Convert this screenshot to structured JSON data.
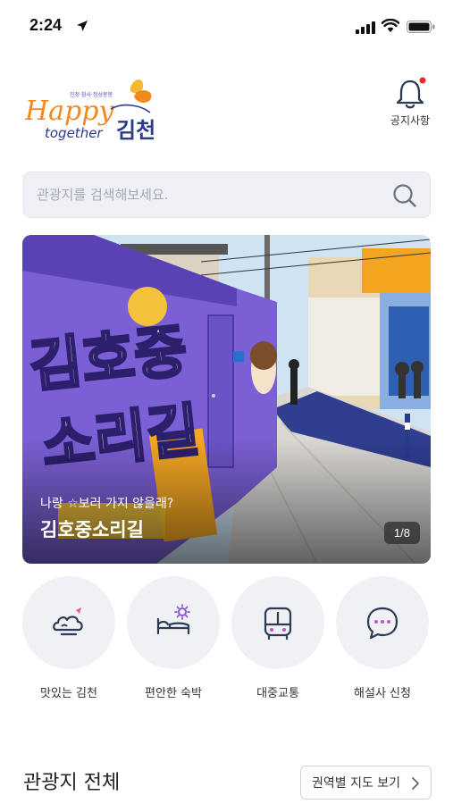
{
  "status_bar": {
    "time": "2:24",
    "icons": [
      "location-arrow-icon",
      "signal-icon",
      "wifi-icon",
      "battery-icon"
    ]
  },
  "header": {
    "logo_text": "Happy together 김천",
    "logo_small": "진정·참사·정성봉봉",
    "notice_label": "공지사항",
    "notice_icon": "bell-icon"
  },
  "search": {
    "placeholder": "관광지를 검색해보세요.",
    "icon": "search-icon"
  },
  "hero": {
    "subtitle": "나랑 ☆보러 가지 않을래?",
    "title": "김호중소리길",
    "page_indicator": "1/8",
    "mural_text": "김호중 소리길"
  },
  "quick_menu": [
    {
      "label": "맛있는 김천",
      "icon": "food-icon"
    },
    {
      "label": "편안한 숙박",
      "icon": "bed-icon"
    },
    {
      "label": "대중교통",
      "icon": "bus-icon"
    },
    {
      "label": "해설사 신청",
      "icon": "chat-bubble-icon"
    }
  ],
  "section": {
    "title": "관광지 전체",
    "map_button": "권역별 지도 보기"
  },
  "colors": {
    "accent_purple": "#5b4bd6",
    "logo_orange": "#f08a1c",
    "logo_blue": "#2a3a8c",
    "badge_red": "#e8262d",
    "search_bg": "#eef0f5",
    "circle_bg": "#f0f1f5"
  }
}
